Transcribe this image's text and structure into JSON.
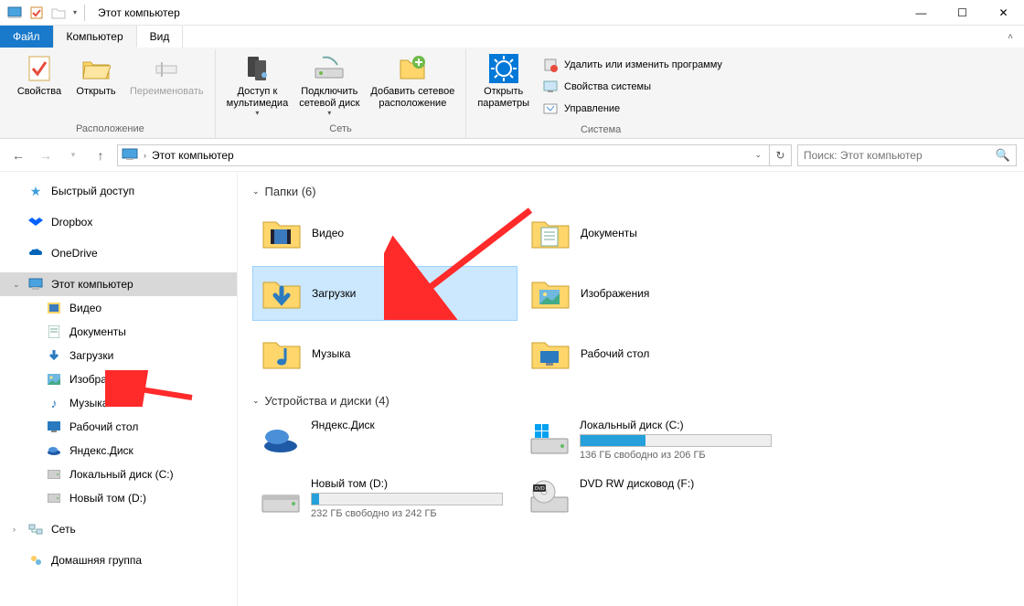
{
  "window": {
    "title": "Этот компьютер",
    "controls": {
      "min": "—",
      "max": "☐",
      "close": "✕"
    }
  },
  "tabs": {
    "file": "Файл",
    "computer": "Компьютер",
    "view": "Вид"
  },
  "ribbon": {
    "location": {
      "properties": "Свойства",
      "open": "Открыть",
      "rename": "Переименовать",
      "label": "Расположение"
    },
    "network": {
      "media": "Доступ к\nмультимедиа",
      "map_drive": "Подключить\nсетевой диск",
      "add_location": "Добавить сетевое\nрасположение",
      "label": "Сеть"
    },
    "system": {
      "settings": "Открыть\nпараметры",
      "uninstall": "Удалить или изменить программу",
      "sys_props": "Свойства системы",
      "manage": "Управление",
      "label": "Система"
    }
  },
  "nav": {
    "breadcrumb": "Этот компьютер",
    "search_placeholder": "Поиск: Этот компьютер"
  },
  "sidebar": {
    "quick": "Быстрый доступ",
    "dropbox": "Dropbox",
    "onedrive": "OneDrive",
    "thispc": "Этот компьютер",
    "video": "Видео",
    "documents": "Документы",
    "downloads": "Загрузки",
    "pictures": "Изображения",
    "music": "Музыка",
    "desktop": "Рабочий стол",
    "yadisk": "Яндекс.Диск",
    "localc": "Локальный диск (C:)",
    "newd": "Новый том (D:)",
    "network": "Сеть",
    "homegroup": "Домашняя группа"
  },
  "content": {
    "folders_header": "Папки (6)",
    "folders": {
      "video": "Видео",
      "documents": "Документы",
      "downloads": "Загрузки",
      "pictures": "Изображения",
      "music": "Музыка",
      "desktop": "Рабочий стол"
    },
    "drives_header": "Устройства и диски (4)",
    "drives": {
      "yadisk": {
        "name": "Яндекс.Диск"
      },
      "c": {
        "name": "Локальный диск (C:)",
        "free": "136 ГБ свободно из 206 ГБ",
        "pct": 34
      },
      "d": {
        "name": "Новый том (D:)",
        "free": "232 ГБ свободно из 242 ГБ",
        "pct": 4
      },
      "dvd": {
        "name": "DVD RW дисковод (F:)"
      }
    }
  }
}
